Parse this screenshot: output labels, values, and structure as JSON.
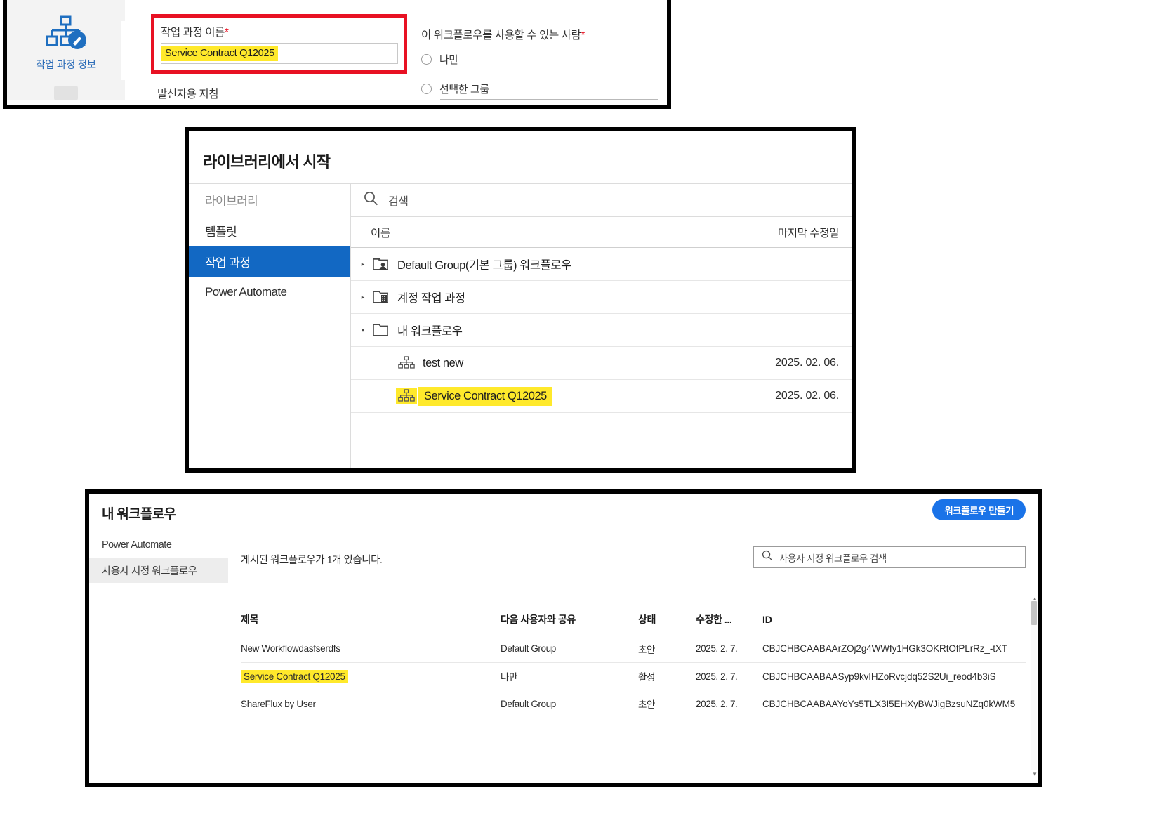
{
  "panel_top": {
    "sidebar": {
      "icon": "workflow-edit-icon",
      "caption": "작업 과정 정보"
    },
    "name_field": {
      "label": "작업 과정 이름",
      "required_mark": "*",
      "value": "Service Contract Q12025"
    },
    "instructions_label": "발신자용 지침",
    "audience": {
      "label": "이 워크플로우를 사용할 수 있는 사람",
      "required_mark": "*",
      "options": [
        {
          "label": "나만",
          "selected": false
        },
        {
          "label": "선택한 그룹",
          "selected": false
        }
      ]
    },
    "highlight_color": "#ffe92b",
    "callout_color": "#e81123"
  },
  "panel_mid": {
    "title": "라이브러리에서 시작",
    "search_placeholder": "검색",
    "search_icon": "search-icon",
    "sidebar": [
      {
        "label": "라이브러리",
        "type": "header",
        "active": false
      },
      {
        "label": "템플릿",
        "type": "item",
        "active": false
      },
      {
        "label": "작업 과정",
        "type": "item",
        "active": true
      },
      {
        "label": "Power Automate",
        "type": "item",
        "active": false
      }
    ],
    "columns": {
      "name": "이름",
      "modified": "마지막 수정일"
    },
    "rows": [
      {
        "caret": "▸",
        "icon": "folder-user-icon",
        "name": "Default Group(기본 그룹) 워크플로우",
        "date": "",
        "indent": 0,
        "highlight": false,
        "link": false
      },
      {
        "caret": "▸",
        "icon": "folder-building-icon",
        "name": "계정 작업 과정",
        "date": "",
        "indent": 0,
        "highlight": false,
        "link": false
      },
      {
        "caret": "▾",
        "icon": "folder-icon",
        "name": "내 워크플로우",
        "date": "",
        "indent": 0,
        "highlight": false,
        "link": false
      },
      {
        "caret": "",
        "icon": "workflow-icon",
        "name": "test new",
        "date": "2025. 02. 06.",
        "indent": 1,
        "highlight": false,
        "link": false
      },
      {
        "caret": "",
        "icon": "workflow-icon",
        "name": "Service Contract Q12025",
        "date": "2025. 02. 06.",
        "indent": 1,
        "highlight": true,
        "link": true
      }
    ],
    "active_color": "#1268c3"
  },
  "panel_bot": {
    "title": "내 워크플로우",
    "create_button": "워크플로우 만들기",
    "sidebar": [
      {
        "label": "Power Automate",
        "active": false
      },
      {
        "label": "사용자 지정 워크플로우",
        "active": true
      }
    ],
    "count_text": "게시된 워크플로우가 1개 있습니다.",
    "search_placeholder": "사용자 지정 워크플로우 검색",
    "search_icon": "search-icon",
    "columns": [
      "제목",
      "다음 사용자와 공유",
      "상태",
      "수정한 ...",
      "ID"
    ],
    "rows": [
      {
        "title": "New Workflowdasfserdfs",
        "shared": "Default Group",
        "state": "초안",
        "modified": "2025. 2. 7.",
        "id": "CBJCHBCAABAArZOj2g4WWfy1HGk3OKRtOfPLrRz_-tXT",
        "highlight": false
      },
      {
        "title": "Service Contract Q12025",
        "shared": "나만",
        "state": "활성",
        "modified": "2025. 2. 7.",
        "id": "CBJCHBCAABAASyp9kvIHZoRvcjdq52S2Ui_reod4b3iS",
        "highlight": true
      },
      {
        "title": "ShareFlux by User",
        "shared": "Default Group",
        "state": "초안",
        "modified": "2025. 2. 7.",
        "id": "CBJCHBCAABAAYoYs5TLX3I5EHXyBWJigBzsuNZq0kWM5",
        "highlight": false
      }
    ],
    "accent_color": "#1a73e8"
  }
}
